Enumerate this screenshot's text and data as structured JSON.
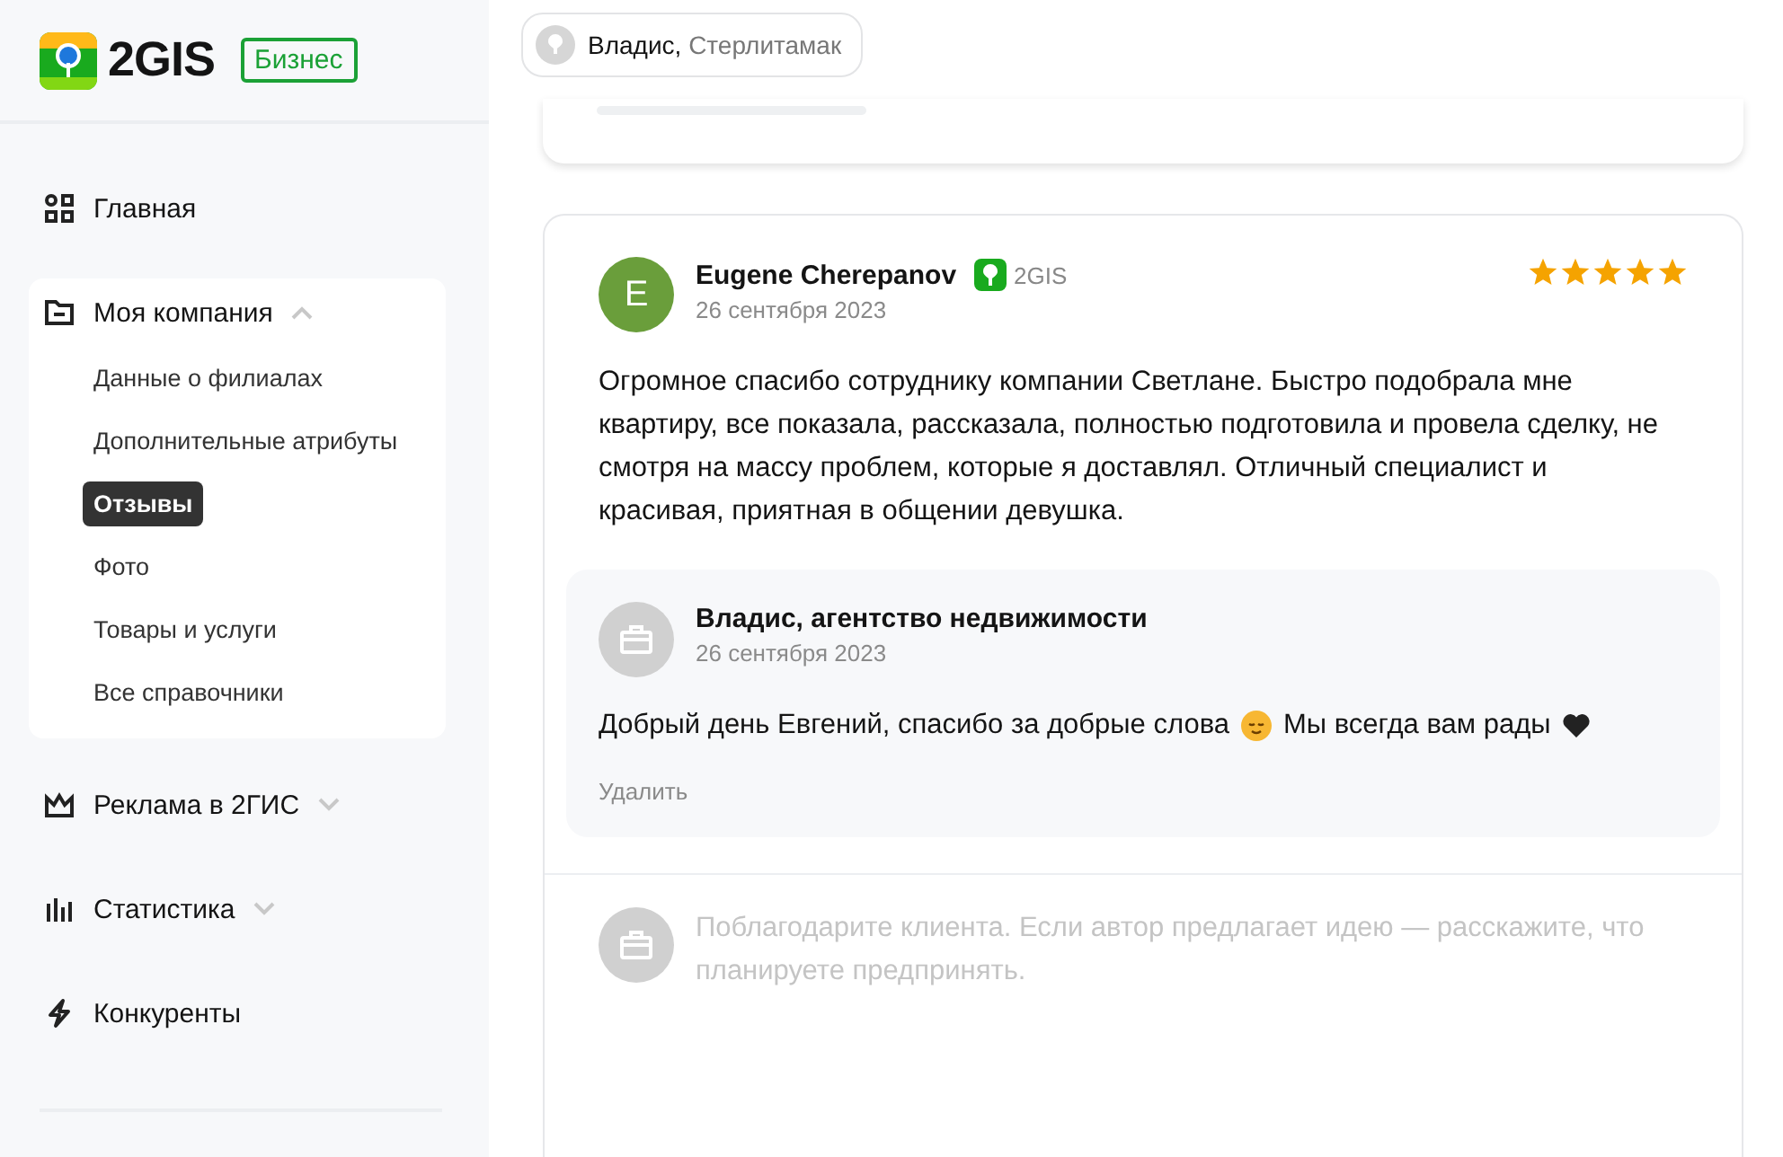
{
  "logo": {
    "text": "2GIS",
    "badge": "Бизнес"
  },
  "account": {
    "name": "Владис,",
    "city": "Стерлитамак"
  },
  "sidebar": {
    "items": [
      {
        "kind": "grid",
        "label": "Главная"
      },
      {
        "kind": "folder",
        "label": "Моя компания",
        "expanded": true,
        "children": [
          {
            "label": "Данные о филиалах",
            "selected": false
          },
          {
            "label": "Дополнительные атрибуты",
            "selected": false
          },
          {
            "label": "Отзывы",
            "selected": true
          },
          {
            "label": "Фото",
            "selected": false
          },
          {
            "label": "Товары и услуги",
            "selected": false
          },
          {
            "label": "Все справочники",
            "selected": false
          }
        ]
      },
      {
        "kind": "crown",
        "label": "Реклама в 2ГИС",
        "expanded": false
      },
      {
        "kind": "bars",
        "label": "Статистика",
        "expanded": false
      },
      {
        "kind": "bolt",
        "label": "Конкуренты"
      }
    ]
  },
  "review": {
    "initial": "E",
    "author": "Eugene Cherepanov",
    "source": "2GIS",
    "date": "26 сентября 2023",
    "stars": 5,
    "text": "Огромное спасибо сотруднику компании Светлане. Быстро подобрала мне квартиру, все показала, рассказала, полностью подготовила и провела сделку, не смотря на массу проблем, которые я доставлял. Отличный специалист и красивая, приятная в общении девушка.",
    "reply": {
      "author": "Владис, агентство недвижимости",
      "date": "26 сентября 2023",
      "parts": [
        {
          "kind": "text",
          "text": "Добрый день Евгений, спасибо за добрые слова"
        },
        {
          "kind": "smile"
        },
        {
          "kind": "text",
          "text": "Мы всегда вам рады"
        },
        {
          "kind": "heart"
        }
      ],
      "delete": "Удалить"
    },
    "reply_field": {
      "placeholder": "Поблагодарите клиента. Если автор предлагает идею — расскажите, что планируете предпринять."
    }
  }
}
